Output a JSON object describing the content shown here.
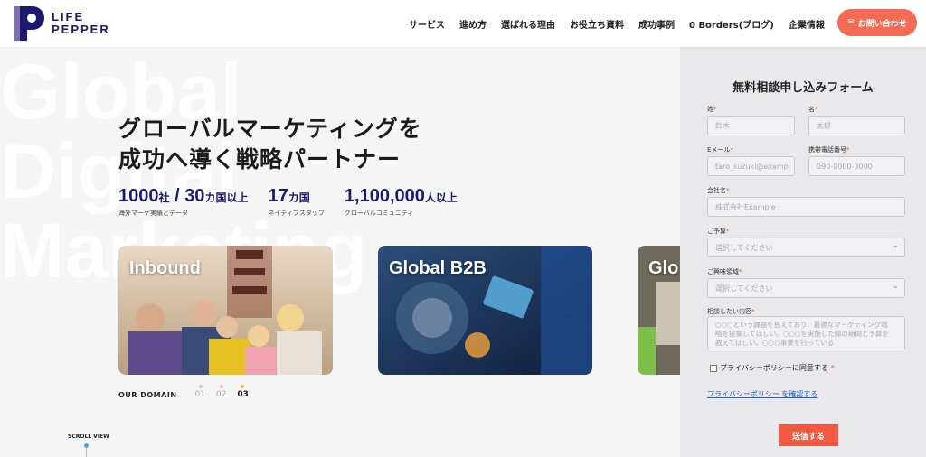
{
  "brand": {
    "line1": "LIFE",
    "line2": "PEPPER"
  },
  "nav": [
    "サービス",
    "進め方",
    "選ばれる理由",
    "お役立ち資料",
    "成功事例",
    "0 Borders(ブログ)",
    "企業情報"
  ],
  "contact_button": "お問い合わせ",
  "hero": {
    "bg_lines": [
      "Global",
      "Digital",
      "Marketing"
    ],
    "title_line1": "グローバルマーケティングを",
    "title_line2": "成功へ導く戦略パートナー"
  },
  "stats": [
    {
      "value1": "1000",
      "unit1": "社",
      "sep": " / ",
      "value2": "30",
      "unit2": "カ国以上",
      "caption": "海外マーケ実績とデータ"
    },
    {
      "value1": "17",
      "unit1": "カ国",
      "caption": "ネイティブスタッフ"
    },
    {
      "value1": "1,100,000",
      "unit1": "人以上",
      "caption": "グローバルコミュニティ"
    }
  ],
  "cards": [
    "Inbound",
    "Global B2B",
    "Glo"
  ],
  "domain": {
    "title": "OUR DOMAIN",
    "items": [
      "01",
      "02",
      "03"
    ],
    "active": "03"
  },
  "scroll_label": "SCROLL VIEW",
  "form": {
    "title": "無料相談申し込みフォーム",
    "last_name": {
      "label": "姓",
      "placeholder": "鈴木"
    },
    "first_name": {
      "label": "名",
      "placeholder": "太郎"
    },
    "email": {
      "label": "Eメール",
      "placeholder": "taro_suzuki@examp"
    },
    "phone": {
      "label": "携帯電話番号",
      "placeholder": "090-0000-0000"
    },
    "company": {
      "label": "会社名",
      "placeholder": "株式会社Example"
    },
    "budget": {
      "label": "ご予算",
      "value": "選択してください"
    },
    "interest": {
      "label": "ご興味領域",
      "value": "選択してください"
    },
    "inquiry": {
      "label": "相談したい内容",
      "placeholder": "○○○という課題を抱えており、最適なマーケティング戦略を提案してほしい。○○○を実施した際の期間と予算を教えてほしい。○○○事業を行っている"
    },
    "privacy_check": "プライバシーポリシーに同意する",
    "privacy_link": "プライバシーポリシー を確認する",
    "submit": "送信する"
  },
  "colors": {
    "brand": "#1b1a6e",
    "accent": "#f36b55",
    "submit": "#f15a40"
  }
}
